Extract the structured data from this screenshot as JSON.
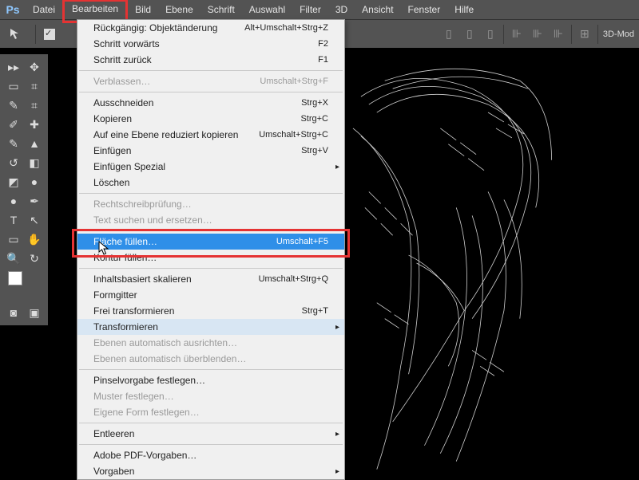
{
  "app": {
    "logo": "Ps"
  },
  "menubar": {
    "items": [
      "Datei",
      "Bearbeiten",
      "Bild",
      "Ebene",
      "Schrift",
      "Auswahl",
      "Filter",
      "3D",
      "Ansicht",
      "Fenster",
      "Hilfe"
    ]
  },
  "options_bar": {
    "mode_label": "3D-Mod"
  },
  "edit_menu": {
    "rueckgaengig": {
      "label": "Rückgängig: Objektänderung",
      "shortcut": "Alt+Umschalt+Strg+Z"
    },
    "vorwaerts": {
      "label": "Schritt vorwärts",
      "shortcut": "F2"
    },
    "zurueck": {
      "label": "Schritt zurück",
      "shortcut": "F1"
    },
    "verblassen": {
      "label": "Verblassen…",
      "shortcut": "Umschalt+Strg+F"
    },
    "ausschneiden": {
      "label": "Ausschneiden",
      "shortcut": "Strg+X"
    },
    "kopieren": {
      "label": "Kopieren",
      "shortcut": "Strg+C"
    },
    "auf_ebene_kopieren": {
      "label": "Auf eine Ebene reduziert kopieren",
      "shortcut": "Umschalt+Strg+C"
    },
    "einfuegen": {
      "label": "Einfügen",
      "shortcut": "Strg+V"
    },
    "einfuegen_spezial": {
      "label": "Einfügen Spezial"
    },
    "loeschen": {
      "label": "Löschen"
    },
    "rechtschreib": {
      "label": "Rechtschreibprüfung…"
    },
    "text_suchen": {
      "label": "Text suchen und ersetzen…"
    },
    "flaeche_fuellen": {
      "label": "Fläche füllen…",
      "shortcut": "Umschalt+F5"
    },
    "kontur_fuellen": {
      "label": "Kontur füllen…"
    },
    "inhalt_skalieren": {
      "label": "Inhaltsbasiert skalieren",
      "shortcut": "Umschalt+Strg+Q"
    },
    "formgitter": {
      "label": "Formgitter"
    },
    "frei_transformieren": {
      "label": "Frei transformieren",
      "shortcut": "Strg+T"
    },
    "transformieren": {
      "label": "Transformieren"
    },
    "ebenen_ausrichten": {
      "label": "Ebenen automatisch ausrichten…"
    },
    "ebenen_ueberblenden": {
      "label": "Ebenen automatisch überblenden…"
    },
    "pinselvorgabe": {
      "label": "Pinselvorgabe festlegen…"
    },
    "muster_festlegen": {
      "label": "Muster festlegen…"
    },
    "eigene_form": {
      "label": "Eigene Form festlegen…"
    },
    "entleeren": {
      "label": "Entleeren"
    },
    "pdf_vorgaben": {
      "label": "Adobe PDF-Vorgaben…"
    },
    "vorgaben": {
      "label": "Vorgaben"
    }
  }
}
